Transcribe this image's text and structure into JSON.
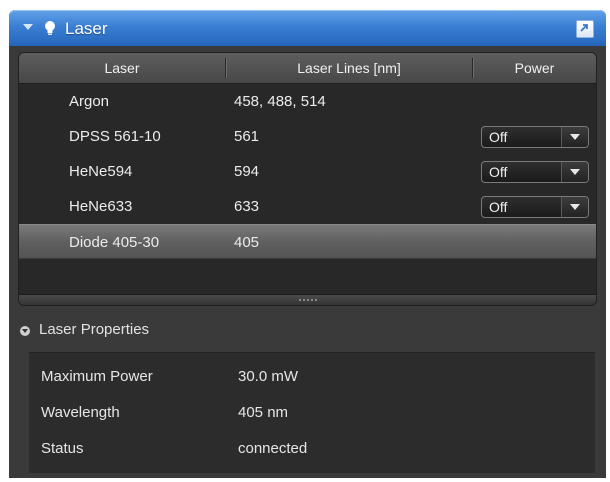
{
  "panel": {
    "title": "Laser",
    "icons": {
      "collapse": "chevron-down-icon",
      "lamp": "lightbulb-icon",
      "undock": "undock-icon"
    },
    "accent_color": "#3a7fd3"
  },
  "laser_table": {
    "columns": [
      "Laser",
      "Laser Lines [nm]",
      "Power"
    ],
    "rows": [
      {
        "laser": "Argon",
        "lines": "458, 488, 514",
        "power": null,
        "selected": false
      },
      {
        "laser": "DPSS 561-10",
        "lines": "561",
        "power": "Off",
        "selected": false
      },
      {
        "laser": "HeNe594",
        "lines": "594",
        "power": "Off",
        "selected": false
      },
      {
        "laser": "HeNe633",
        "lines": "633",
        "power": "Off",
        "selected": false
      },
      {
        "laser": "Diode 405-30",
        "lines": "405",
        "power": null,
        "selected": true
      }
    ]
  },
  "properties": {
    "title": "Laser Properties",
    "items": [
      {
        "key": "Maximum Power",
        "value": "30.0 mW"
      },
      {
        "key": "Wavelength",
        "value": "405 nm"
      },
      {
        "key": "Status",
        "value": "connected"
      }
    ]
  }
}
